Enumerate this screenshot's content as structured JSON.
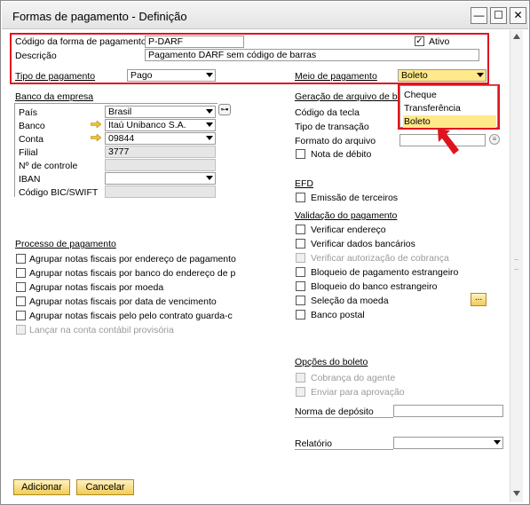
{
  "window": {
    "title": "Formas de pagamento - Definição",
    "minimize_glyph": "—",
    "maximize_glyph": "☐",
    "close_glyph": "✕"
  },
  "header": {
    "code_label": "Código da forma de pagamento",
    "code_value": "P-DARF",
    "active_label": "Ativo",
    "active_checked": true,
    "description_label": "Descrição",
    "description_value": "Pagamento DARF sem código de barras",
    "payment_type_label": "Tipo de pagamento",
    "payment_type_value": "Pago",
    "payment_means_label": "Meio de pagamento",
    "payment_means_value": "Boleto"
  },
  "company_bank": {
    "section_label": "Banco da empresa",
    "country_label": "País",
    "country_value": "Brasil",
    "bank_label": "Banco",
    "bank_value": "Itaú Unibanco S.A.",
    "account_label": "Conta",
    "account_value": "09844",
    "branch_label": "Filial",
    "branch_value": "3777",
    "control_label": "Nº de controle",
    "control_value": "",
    "iban_label": "IBAN",
    "iban_value": "",
    "swift_label": "Código BIC/SWIFT",
    "swift_value": ""
  },
  "file_generation": {
    "section_label": "Geração de arquivo de bai",
    "key_code_label": "Código da tecla",
    "transaction_type_label": "Tipo de transação",
    "file_format_label": "Formato do arquivo",
    "debit_note_label": "Nota de débito"
  },
  "means_dropdown": {
    "options": [
      "Cheque",
      "Transferência bancária",
      "Boleto"
    ],
    "selected": "Boleto"
  },
  "efd": {
    "section_label": "EFD",
    "third_party_label": "Emissão de terceiros"
  },
  "payment_process": {
    "section_label": "Processo de pagamento",
    "items": [
      "Agrupar notas fiscais por endereço de pagamento",
      "Agrupar notas fiscais por banco do endereço de p",
      "Agrupar notas fiscais por moeda",
      "Agrupar notas fiscais por data de vencimento",
      "Agrupar notas fiscais pelo pelo contrato guarda-c",
      "Lançar na conta contábil provisória"
    ]
  },
  "validation": {
    "section_label": "Validação do pagamento",
    "items": [
      "Verificar endereço",
      "Verificar dados bancários",
      "Verificar autorização de cobrança",
      "Bloqueio de pagamento estrangeiro",
      "Bloqueio do banco estrangeiro",
      "Seleção da moeda",
      "Banco postal"
    ],
    "more_button": "..."
  },
  "boleto_options": {
    "section_label": "Opções do boleto",
    "agent_collection_label": "Cobrança do agente",
    "send_approval_label": "Enviar para aprovação",
    "deposit_norm_label": "Norma de depósito"
  },
  "report": {
    "label": "Relatório"
  },
  "footer": {
    "add_button": "Adicionar",
    "cancel_button": "Cancelar"
  },
  "colors": {
    "highlight_red": "#e0141e",
    "field_yellow": "#ffe98a",
    "button_gold": "#f1cc55"
  }
}
